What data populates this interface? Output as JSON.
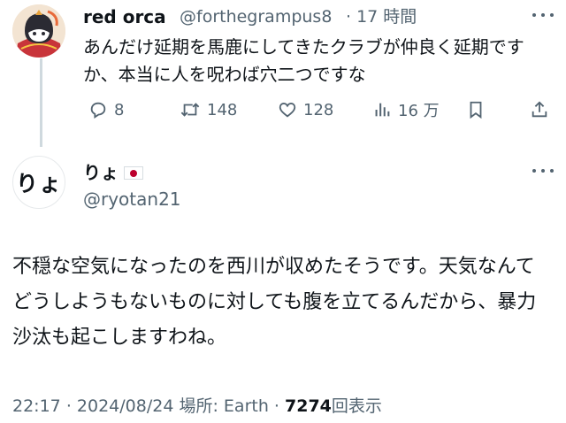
{
  "parent_tweet": {
    "display_name": "red orca",
    "handle": "@forthegrampus8",
    "separator": "·",
    "time_ago": "17 時間",
    "text": "あんだけ延期を馬鹿にしてきたクラブが仲良く延期ですか、本当に人を呪わば穴二つですな",
    "metrics": {
      "replies": "8",
      "reposts": "148",
      "likes": "128",
      "views": "16 万"
    }
  },
  "main_tweet": {
    "display_name": "りょ",
    "flag_emoji": "🇯🇵",
    "handle": "@ryotan21",
    "avatar_text": "りょ",
    "text": "不穏な空気になったのを西川が収めたそうです。天気なんてどうしようもないものに対しても腹を立てるんだから、暴力沙汰も起こしますわね。",
    "time": "22:17",
    "date": "2024/08/24",
    "location_label": "場所:",
    "location": "Earth",
    "view_count": "7274",
    "view_label": "回表示",
    "separator": "·"
  },
  "colors": {
    "text_primary": "#0f1419",
    "text_secondary": "#536471",
    "thread_line": "#cfd9de",
    "flag_red": "#bc002d"
  },
  "icons": {
    "reply": "reply-icon",
    "repost": "repost-icon",
    "like": "like-icon",
    "views": "views-icon",
    "bookmark": "bookmark-icon",
    "share": "share-icon",
    "more": "more-icon"
  }
}
